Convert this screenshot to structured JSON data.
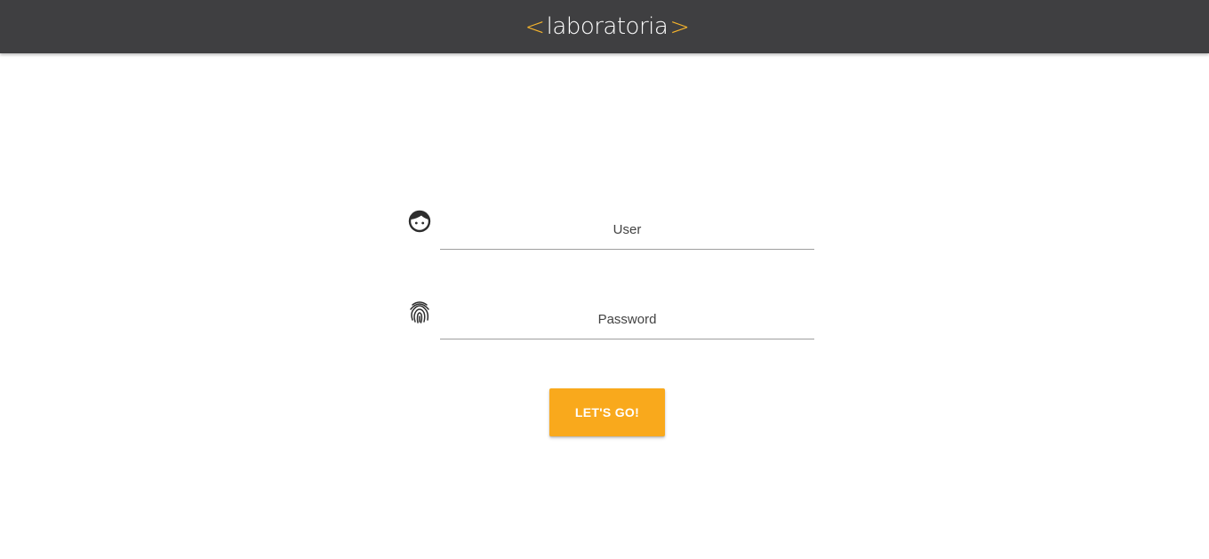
{
  "header": {
    "logo": {
      "open_bracket": "<",
      "word": "laboratoria",
      "close_bracket": ">"
    }
  },
  "login_form": {
    "user": {
      "icon": "face-icon",
      "placeholder": "User",
      "value": ""
    },
    "password": {
      "icon": "fingerprint-icon",
      "placeholder": "Password",
      "value": ""
    },
    "submit_label": "LET'S GO!"
  },
  "colors": {
    "header_bg": "#3f3f41",
    "accent": "#f9a91c",
    "logo_bracket": "#f7b52c"
  }
}
